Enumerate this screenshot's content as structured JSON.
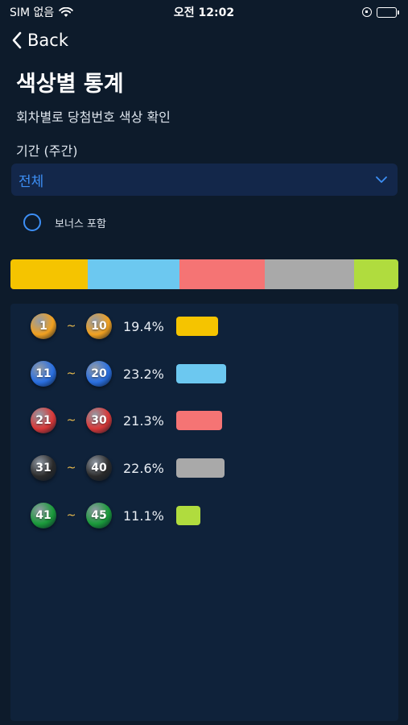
{
  "status": {
    "carrier": "SIM 없음",
    "time": "오전 12:02",
    "battery_color": "#4cd964"
  },
  "nav": {
    "back_label": "Back"
  },
  "page": {
    "title": "색상별 통계",
    "subtitle": "회차별로 당첨번호 색상 확인"
  },
  "period": {
    "label": "기간 (주간)",
    "selected": "전체"
  },
  "bonus": {
    "label": "보너스 포함",
    "checked": false
  },
  "groups": [
    {
      "from": "1",
      "to": "10",
      "percent_text": "19.4%",
      "percent": 19.4,
      "color": "#f5c400",
      "ball_color": "#f0a020"
    },
    {
      "from": "11",
      "to": "20",
      "percent_text": "23.2%",
      "percent": 23.2,
      "color": "#6cc8f0",
      "ball_color": "#2a6fe0"
    },
    {
      "from": "21",
      "to": "30",
      "percent_text": "21.3%",
      "percent": 21.3,
      "color": "#f57474",
      "ball_color": "#d83838"
    },
    {
      "from": "31",
      "to": "40",
      "percent_text": "22.6%",
      "percent": 22.6,
      "color": "#a9a9a9",
      "ball_color": "#2a2a2a"
    },
    {
      "from": "41",
      "to": "45",
      "percent_text": "11.1%",
      "percent": 11.1,
      "color": "#b0dc3e",
      "ball_color": "#1a9a3a"
    }
  ]
}
